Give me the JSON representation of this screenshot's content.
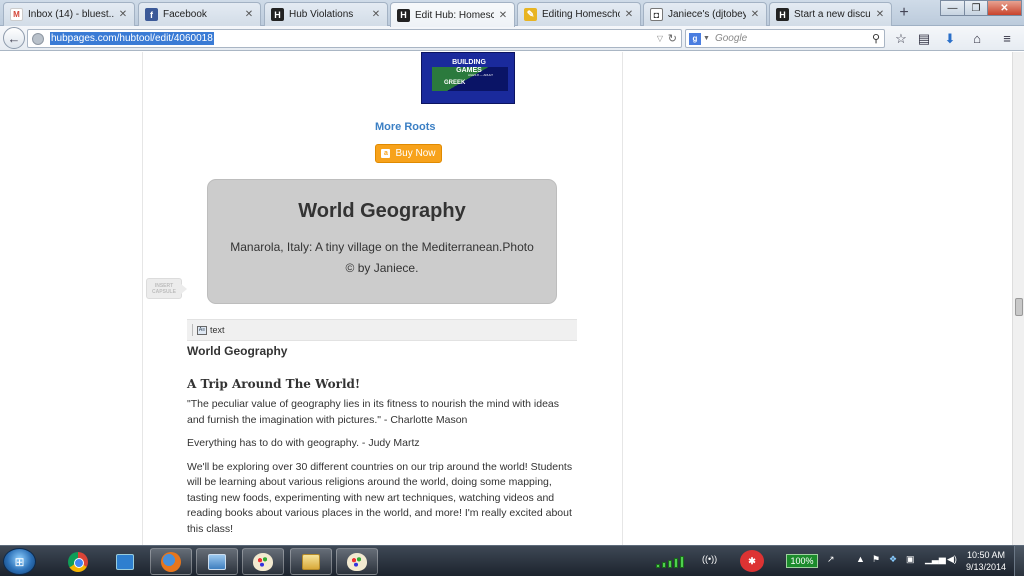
{
  "browser": {
    "tabs": [
      {
        "label": "Inbox (14) - bluest...",
        "favicon": "gmail-icon",
        "active": false
      },
      {
        "label": "Facebook",
        "favicon": "facebook-icon",
        "active": false
      },
      {
        "label": "Hub Violations",
        "favicon": "hubpages-icon",
        "active": false
      },
      {
        "label": "Edit Hub: Homesc...",
        "favicon": "hubpages-icon",
        "active": true
      },
      {
        "label": "Editing Homescho...",
        "favicon": "edit-icon",
        "active": false
      },
      {
        "label": "Janiece's (djtobey_...",
        "favicon": "camera-icon",
        "active": false
      },
      {
        "label": "Start a new discuss...",
        "favicon": "hubpages-icon",
        "active": false
      }
    ],
    "new_tab_label": "+",
    "url": "hubpages.com/hubtool/edit/4060018",
    "search_placeholder": "Google",
    "window_controls": {
      "minimize": "—",
      "maximize": "❐",
      "close": "✕"
    }
  },
  "page": {
    "book_cover": {
      "title": "BUILDING GAMES",
      "subtitle": "GREEK",
      "ages": "AGES 8 — ADULT"
    },
    "more_roots_link": "More Roots",
    "buy_now_button": "Buy Now",
    "photo_capsule": {
      "title": "World Geography",
      "caption": "Manarola, Italy: A tiny village on the Mediterranean.Photo © by Janiece."
    },
    "insert_capsule_label": "INSERT CAPSULE",
    "text_capsule": {
      "toolbar_label": "text",
      "heading": "World Geography",
      "subheading": "A Trip Around The World!",
      "paragraphs": [
        "\"The peculiar value of geography lies in its fitness to nourish the mind with ideas and furnish the imagination with pictures.\" - Charlotte Mason",
        "Everything has to do with geography. - Judy Martz",
        "We'll be exploring over 30 different countries on our trip around the world! Students will be learning about various religions around the world, doing some mapping, tasting new foods, experimenting with new art techniques, watching videos and reading books about various places in the world, and more! I'm really excited about this class!"
      ]
    }
  },
  "taskbar": {
    "battery_percent": "100%",
    "clock_time": "10:50 AM",
    "clock_date": "9/13/2014",
    "signal_bars": 5
  },
  "colors": {
    "link_blue": "#3b7fc4",
    "buy_orange": "#f7a21b",
    "capsule_gray": "#cccccc",
    "url_highlight": "#3a7bd5"
  }
}
